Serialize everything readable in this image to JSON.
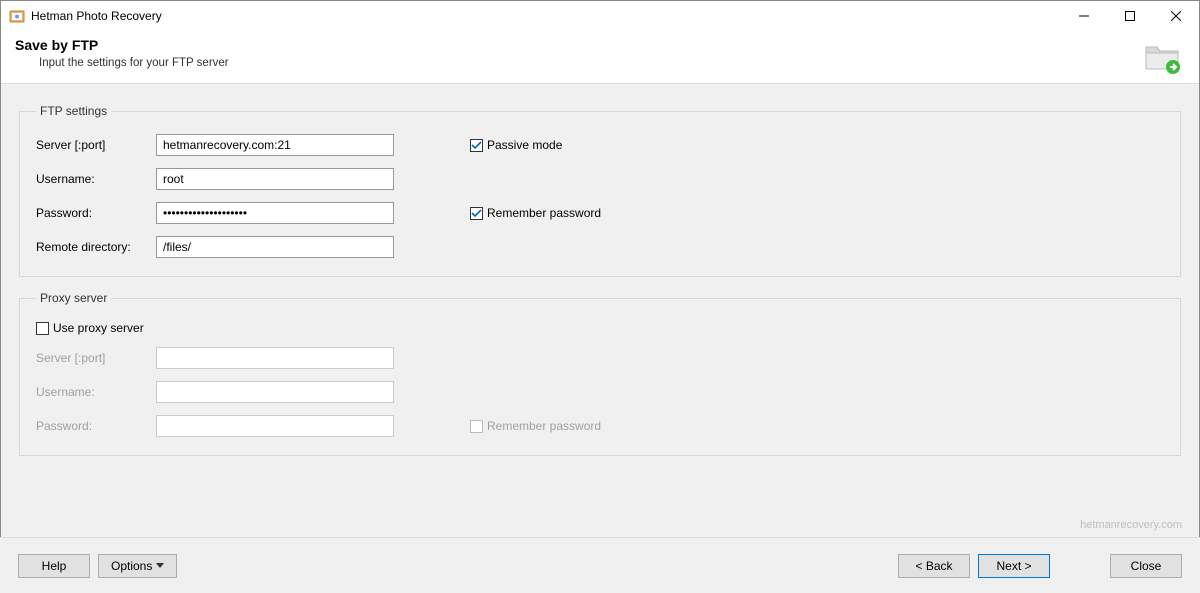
{
  "titlebar": {
    "title": "Hetman Photo Recovery"
  },
  "header": {
    "title": "Save by FTP",
    "subtitle": "Input the settings for your FTP server"
  },
  "ftp": {
    "legend": "FTP settings",
    "server_label": "Server [:port]",
    "server_value": "hetmanrecovery.com:21",
    "username_label": "Username:",
    "username_value": "root",
    "password_label": "Password:",
    "password_value": "••••••••••••••••••••",
    "remote_dir_label": "Remote directory:",
    "remote_dir_value": "/files/",
    "passive_mode_label": "Passive mode",
    "remember_password_label": "Remember password"
  },
  "proxy": {
    "legend": "Proxy server",
    "use_proxy_label": "Use proxy server",
    "server_label": "Server [:port]",
    "username_label": "Username:",
    "password_label": "Password:",
    "remember_password_label": "Remember password"
  },
  "footer": {
    "help": "Help",
    "options": "Options",
    "back": "< Back",
    "next": "Next >",
    "close": "Close"
  },
  "watermark": "hetmanrecovery.com"
}
